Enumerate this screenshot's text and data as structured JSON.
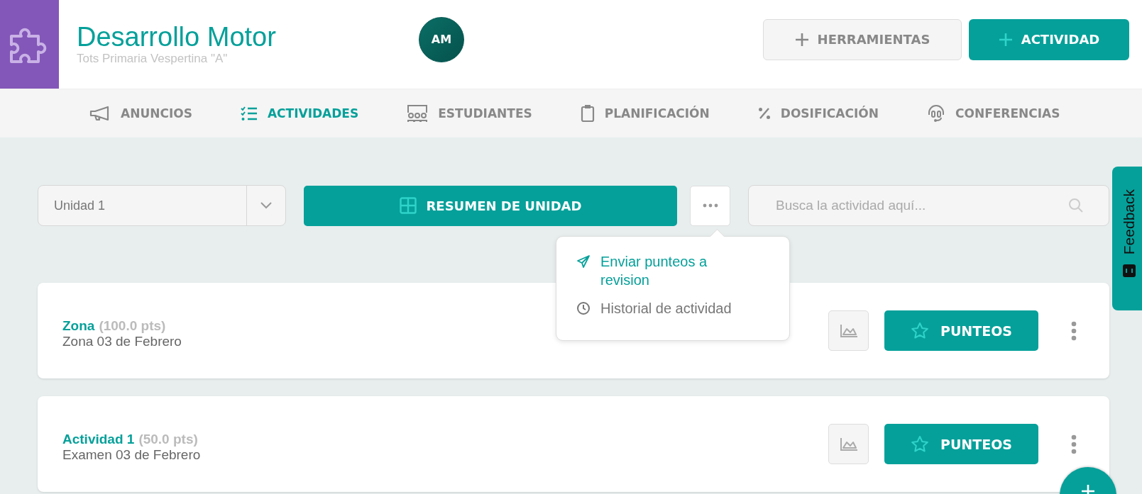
{
  "header": {
    "title": "Desarrollo Motor",
    "subtitle": "Tots Primaria Vespertina \"A\"",
    "avatar": "AM",
    "buttons": [
      {
        "label": "HERRAMIENTAS",
        "kind": "secondary"
      },
      {
        "label": "ACTIVIDAD",
        "kind": "primary"
      }
    ]
  },
  "nav": [
    {
      "label": "ANUNCIOS",
      "kind": "megaphone",
      "selected": false
    },
    {
      "label": "ACTIVIDADES",
      "kind": "checklist",
      "selected": true
    },
    {
      "label": "ESTUDIANTES",
      "kind": "students",
      "selected": false
    },
    {
      "label": "PLANIFICACIÓN",
      "kind": "clipboard",
      "selected": false
    },
    {
      "label": "DOSIFICACIÓN",
      "kind": "percent",
      "selected": false
    },
    {
      "label": "CONFERENCIAS",
      "kind": "headset",
      "selected": false
    }
  ],
  "toolbar": {
    "unit_select": "Unidad 1",
    "summary_button": "RESUMEN DE UNIDAD",
    "search": {
      "placeholder": "Busca la actividad aquí..."
    }
  },
  "more_menu": [
    {
      "label": "Enviar punteos a revision",
      "kind": "send",
      "highlighted": true
    },
    {
      "label": "Historial de actividad",
      "kind": "clock",
      "highlighted": false
    }
  ],
  "activities": [
    {
      "title": "Zona",
      "points": "(100.0 pts)",
      "subtitle": "Zona 03 de Febrero",
      "button": "PUNTEOS"
    },
    {
      "title": "Actividad 1",
      "points": "(50.0 pts)",
      "subtitle": "Examen 03 de Febrero",
      "button": "PUNTEOS"
    }
  ],
  "feedback_tab": "Feedback"
}
